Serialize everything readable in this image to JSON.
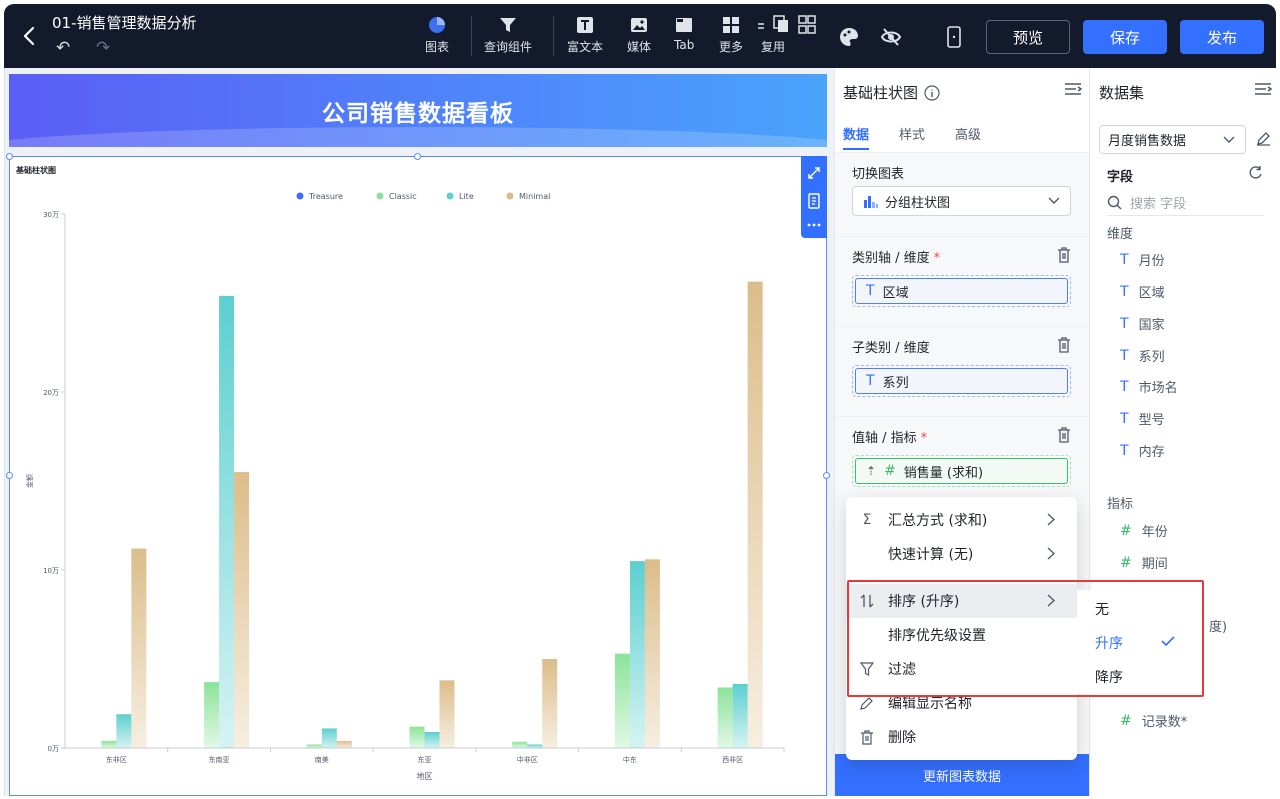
{
  "topbar": {
    "title": "01-销售管理数据分析",
    "tools": [
      {
        "label": "图表",
        "icon": "pie-chart-icon"
      },
      {
        "label": "查询组件",
        "icon": "filter-icon"
      },
      {
        "label": "富文本",
        "icon": "text-icon"
      },
      {
        "label": "媒体",
        "icon": "image-icon"
      },
      {
        "label": "Tab",
        "icon": "tab-icon"
      },
      {
        "label": "更多",
        "icon": "grid-icon"
      },
      {
        "label": "复用",
        "icon": "reuse-icon"
      }
    ],
    "preview_label": "预览",
    "save_label": "保存",
    "publish_label": "发布"
  },
  "banner": {
    "title": "公司销售数据看板"
  },
  "chart_data": {
    "type": "bar",
    "title": "基础柱状图",
    "xlabel": "地区",
    "ylabel": "金额",
    "ylim": [
      0,
      300000
    ],
    "y_ticks": [
      "0万",
      "10万",
      "20万",
      "30万"
    ],
    "categories": [
      "东非区",
      "东南亚",
      "南美",
      "东亚",
      "中非区",
      "中东",
      "西非区"
    ],
    "series": [
      {
        "name": "Treasure",
        "color": "#3e6ff0",
        "values": [
          0,
          0,
          0,
          0,
          0,
          0,
          0
        ]
      },
      {
        "name": "Classic",
        "color": "#8be39a",
        "values": [
          4000,
          37000,
          2000,
          12000,
          3500,
          53000,
          34000
        ]
      },
      {
        "name": "Lite",
        "color": "#5ccfd0",
        "values": [
          19000,
          254000,
          11000,
          9000,
          2000,
          105000,
          36000
        ]
      },
      {
        "name": "Minimal",
        "color": "#dcbd8a",
        "values": [
          112000,
          155000,
          4000,
          38000,
          50000,
          106000,
          262000
        ]
      }
    ],
    "grid": false,
    "legend": "top"
  },
  "mid_panel": {
    "title": "基础柱状图",
    "tabs": [
      "数据",
      "样式",
      "高级"
    ],
    "switch_label": "切换图表",
    "chart_type": "分组柱状图",
    "category_axis_label": "类别轴 / 维度",
    "category_value": "区域",
    "subcategory_label": "子类别 / 维度",
    "subcategory_value": "系列",
    "value_axis_label": "值轴 / 指标",
    "value_value": "销售量 (求和)",
    "update_button": "更新图表数据"
  },
  "menu": {
    "items": [
      {
        "label": "汇总方式 (求和)",
        "icon": "sigma-icon",
        "has_sub": true
      },
      {
        "label": "快速计算 (无)",
        "icon": "",
        "has_sub": true
      },
      {
        "label": "排序 (升序)",
        "icon": "sort-icon",
        "has_sub": true
      },
      {
        "label": "排序优先级设置",
        "icon": "",
        "has_sub": false
      },
      {
        "label": "过滤",
        "icon": "funnel-icon",
        "has_sub": false
      },
      {
        "label": "编辑显示名称",
        "icon": "pencil-icon",
        "has_sub": false
      },
      {
        "label": "删除",
        "icon": "trash-icon",
        "has_sub": false
      }
    ],
    "sort_options": [
      "无",
      "升序",
      "降序"
    ],
    "sort_selected": "升序"
  },
  "right_panel": {
    "title": "数据集",
    "dataset": "月度销售数据",
    "fields_label": "字段",
    "search_placeholder": "搜索 字段",
    "dimension_label": "维度",
    "dimensions": [
      "月份",
      "区域",
      "国家",
      "系列",
      "市场名",
      "型号",
      "内存"
    ],
    "metric_label": "指标",
    "metrics": [
      "年份",
      "期间"
    ],
    "partial_text": "度)",
    "last_metric": "记录数*"
  }
}
